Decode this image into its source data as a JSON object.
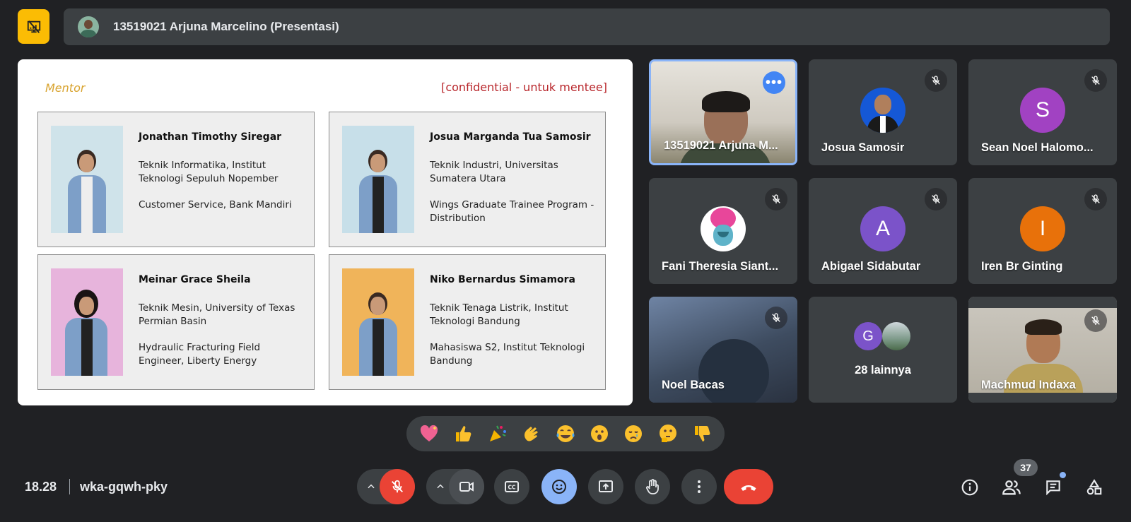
{
  "header": {
    "title": "13519021 Arjuna Marcelino (Presentasi)"
  },
  "slide": {
    "section_label": "Mentor",
    "confidential_label": "[confidential - untuk mentee]",
    "mentors": [
      {
        "name": "Jonathan Timothy Siregar",
        "education": "Teknik Informatika, Institut Teknologi Sepuluh Nopember",
        "job": "Customer Service, Bank Mandiri",
        "bg": "#cfe3ea"
      },
      {
        "name": "Josua Marganda Tua Samosir",
        "education": "Teknik Industri, Universitas Sumatera Utara",
        "job": "Wings Graduate Trainee Program - Distribution",
        "bg": "#c7dfe9"
      },
      {
        "name": "Meinar Grace Sheila",
        "education": "Teknik Mesin, University of Texas Permian Basin",
        "job": "Hydraulic Fracturing Field Engineer, Liberty Energy",
        "bg": "#e7b4dc"
      },
      {
        "name": "Niko Bernardus Simamora",
        "education": "Teknik Tenaga Listrik, Institut Teknologi Bandung",
        "job": "Mahasiswa S2, Institut Teknologi Bandung",
        "bg": "#f0b45a"
      }
    ]
  },
  "participants": [
    {
      "name": "13519021 Arjuna M...",
      "type": "video",
      "pinned": true
    },
    {
      "name": "Josua Samosir",
      "type": "photo",
      "muted": true
    },
    {
      "name": "Sean Noel Halomo...",
      "type": "letter",
      "letter": "S",
      "color": "#a142c2",
      "muted": true
    },
    {
      "name": "Fani Theresia Siant...",
      "type": "photo",
      "muted": true
    },
    {
      "name": "Abigael Sidabutar",
      "type": "letter",
      "letter": "A",
      "color": "#7b53c9",
      "muted": true
    },
    {
      "name": "Iren Br Ginting",
      "type": "letter",
      "letter": "I",
      "color": "#e8710a",
      "muted": true
    },
    {
      "name": "Noel Bacas",
      "type": "video",
      "muted": true
    },
    {
      "name": "28 lainnya",
      "type": "others",
      "letter": "G",
      "color": "#7b53c9"
    },
    {
      "name": "Machmud Indaxa",
      "type": "video",
      "muted": true
    }
  ],
  "reactions": [
    "sparkling-heart",
    "thumbs-up",
    "party-popper",
    "clapping-hands",
    "tears-of-joy",
    "surprised",
    "crying",
    "thinking",
    "thumbs-down"
  ],
  "footer": {
    "time": "18.28",
    "meeting_code": "wka-gqwh-pky",
    "participant_count": "37"
  },
  "colors": {
    "background": "#202124",
    "surface": "#3c4043",
    "danger": "#ea4335",
    "accent": "#8ab4f8",
    "present": "#fbbc04"
  }
}
